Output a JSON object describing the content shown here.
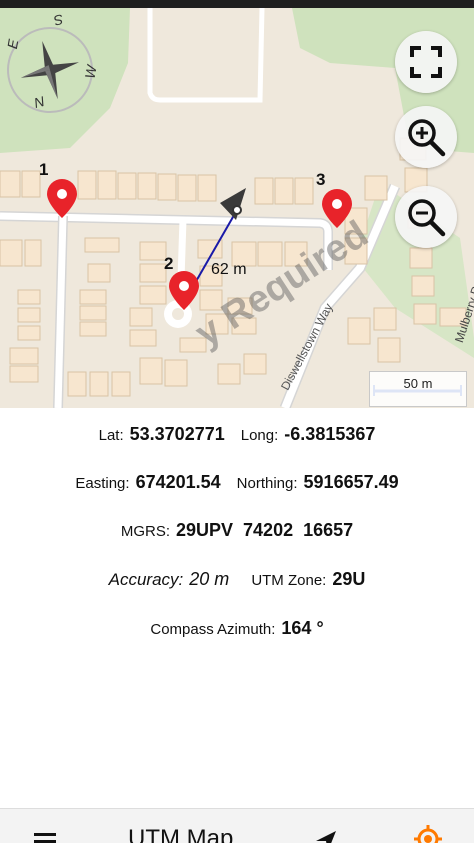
{
  "map": {
    "markers": [
      {
        "label": "1"
      },
      {
        "label": "2"
      },
      {
        "label": "3"
      }
    ],
    "distance_label": "62 m",
    "road_labels": {
      "diswellstown_way": "Diswellstown Way",
      "mulberry_park": "Mulberry Park"
    },
    "compass_letters": {
      "n": "N",
      "e": "E",
      "s": "S",
      "w": "W"
    },
    "scale_label": "50 m",
    "watermark": "y Required",
    "controls": {
      "fullscreen": "fullscreen-icon",
      "zoom_in": "zoom-in-icon",
      "zoom_out": "zoom-out-icon"
    }
  },
  "info": {
    "lat_label": "Lat:",
    "lat_value": "53.3702771",
    "long_label": "Long:",
    "long_value": "-6.3815367",
    "easting_label": "Easting:",
    "easting_value": "674201.54",
    "northing_label": "Northing:",
    "northing_value": "5916657.49",
    "mgrs_label": "MGRS:",
    "mgrs_value": "29UPV  74202  16657",
    "accuracy_label": "Accuracy:",
    "accuracy_value": "20 m",
    "utm_zone_label": "UTM Zone:",
    "utm_zone_value": "29U",
    "azimuth_label": "Compass Azimuth:",
    "azimuth_value": "164 °"
  },
  "bottom_bar": {
    "title": "UTM Map",
    "menu_icon": "menu-icon",
    "navigate_icon": "navigation-arrow-icon",
    "location_icon": "my-location-icon"
  },
  "colors": {
    "marker_red": "#e8232a",
    "line_blue": "#1a1aa8",
    "scale_blue": "#2255c4",
    "accent_orange": "#ff7a00"
  }
}
